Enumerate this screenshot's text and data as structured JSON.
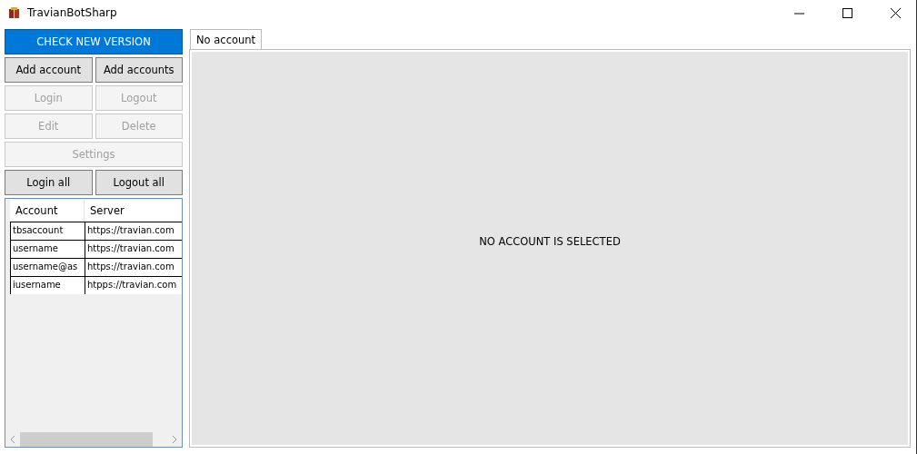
{
  "window": {
    "title": "TravianBotSharp"
  },
  "buttons": [
    {
      "label": "CHECK NEW VERSION",
      "kind": "primary",
      "disabled": false,
      "wide": true
    },
    {
      "label": "Add account",
      "kind": "normal",
      "disabled": false,
      "wide": false
    },
    {
      "label": "Add accounts",
      "kind": "normal",
      "disabled": false,
      "wide": false
    },
    {
      "label": "Login",
      "kind": "normal",
      "disabled": true,
      "wide": false
    },
    {
      "label": "Logout",
      "kind": "normal",
      "disabled": true,
      "wide": false
    },
    {
      "label": "Edit",
      "kind": "normal",
      "disabled": true,
      "wide": false
    },
    {
      "label": "Delete",
      "kind": "normal",
      "disabled": true,
      "wide": false
    },
    {
      "label": "Settings",
      "kind": "normal",
      "disabled": true,
      "wide": true
    },
    {
      "label": "Login all",
      "kind": "normal",
      "disabled": false,
      "wide": false
    },
    {
      "label": "Logout all",
      "kind": "normal",
      "disabled": false,
      "wide": false
    }
  ],
  "table": {
    "columns": [
      "Account",
      "Server"
    ],
    "rows": [
      [
        "tbsaccount",
        "https://travian.com"
      ],
      [
        "username",
        "https://travian.com"
      ],
      [
        "username@as",
        "https://travian.com"
      ],
      [
        "iusername",
        "htpps://travian.com"
      ]
    ]
  },
  "tabs": [
    {
      "label": "No account",
      "selected": true
    }
  ],
  "message": "NO ACCOUNT IS SELECTED"
}
